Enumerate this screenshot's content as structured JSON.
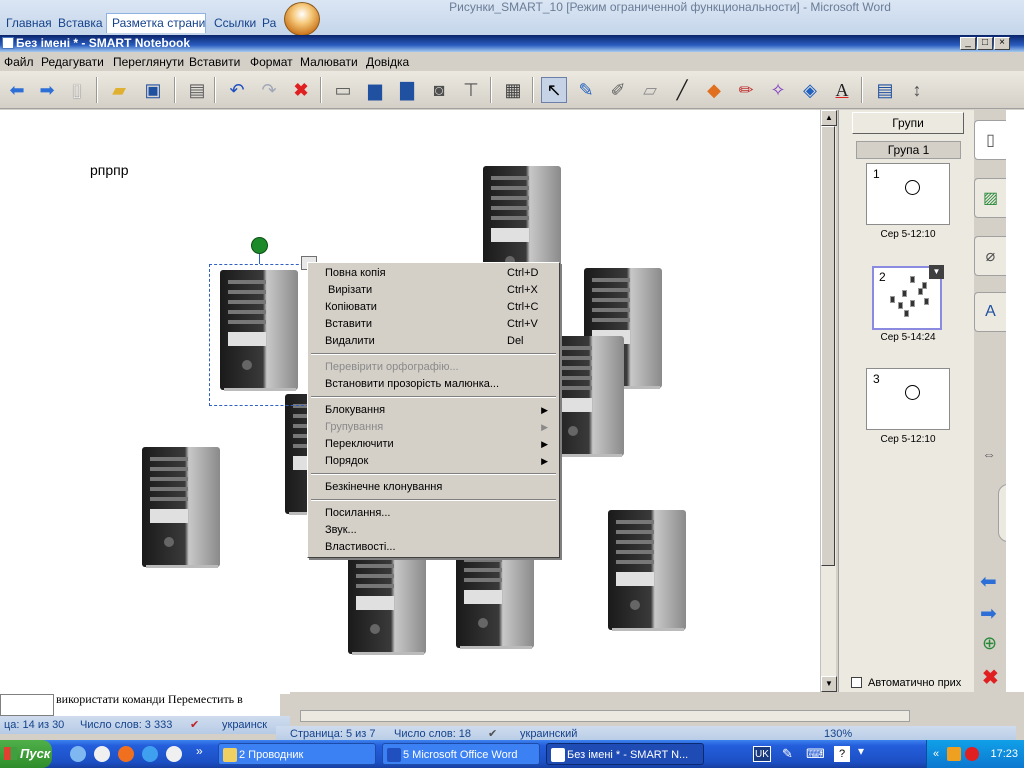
{
  "word": {
    "title": "Рисунки_SMART_10 [Режим ограниченной функциональности] - Microsoft Word",
    "tabs": [
      "Главная",
      "Вставка",
      "Разметка страниц",
      "Ссылки",
      "Ра"
    ],
    "doc_text": "використати команди Переместить в",
    "status_left": {
      "page": "ца: 14 из 30",
      "words": "Число слов: 3 333",
      "lang": "украинск"
    },
    "status_right": {
      "page": "Страница: 5 из 7",
      "words": "Число слов: 18",
      "lang": "украинский",
      "zoom": "130%"
    }
  },
  "smart": {
    "title": "Без імені * - SMART Notebook",
    "menu": [
      "Файл",
      "Редагувати",
      "Переглянути",
      "Вставити",
      "Формат",
      "Малювати",
      "Довідка"
    ],
    "canvas_text": "рпрпр"
  },
  "context_menu": {
    "items": [
      {
        "label": "Повна копія",
        "shortcut": "Ctrl+D"
      },
      {
        "label": " Вирізати",
        "shortcut": "Ctrl+X"
      },
      {
        "label": "Копіювати",
        "shortcut": "Ctrl+C"
      },
      {
        "label": "Вставити",
        "shortcut": "Ctrl+V"
      },
      {
        "label": "Видалити",
        "shortcut": "Del"
      },
      {
        "label": "Перевірити орфографію...",
        "disabled": true
      },
      {
        "label": "Встановити прозорість малюнка..."
      },
      {
        "label": "Блокування",
        "submenu": true
      },
      {
        "label": "Групування",
        "submenu": true,
        "disabled": true
      },
      {
        "label": "Переключити",
        "submenu": true
      },
      {
        "label": "Порядок",
        "submenu": true
      },
      {
        "label": "Безкінечне клонування"
      },
      {
        "label": "Посилання..."
      },
      {
        "label": "Звук..."
      },
      {
        "label": "Властивості..."
      }
    ]
  },
  "side_panel": {
    "groups_button": "Групи",
    "group_label": "Група 1",
    "pages": [
      {
        "num": "1",
        "time": "Сер 5-12:10"
      },
      {
        "num": "2",
        "time": "Сер 5-14:24"
      },
      {
        "num": "3",
        "time": "Сер 5-12:10"
      }
    ],
    "auto_hide": "Автоматично прих"
  },
  "taskbar": {
    "start": "Пуск",
    "tasks": [
      "2 Проводник",
      "5 Microsoft Office Word",
      "Без імені * - SMART N..."
    ],
    "lang": "UK",
    "time": "17:23",
    "overflow": "»"
  },
  "colors": {
    "title_active": "#0a246a",
    "rotate_handle": "#1d8a2a",
    "taskbar": "#245edb"
  }
}
